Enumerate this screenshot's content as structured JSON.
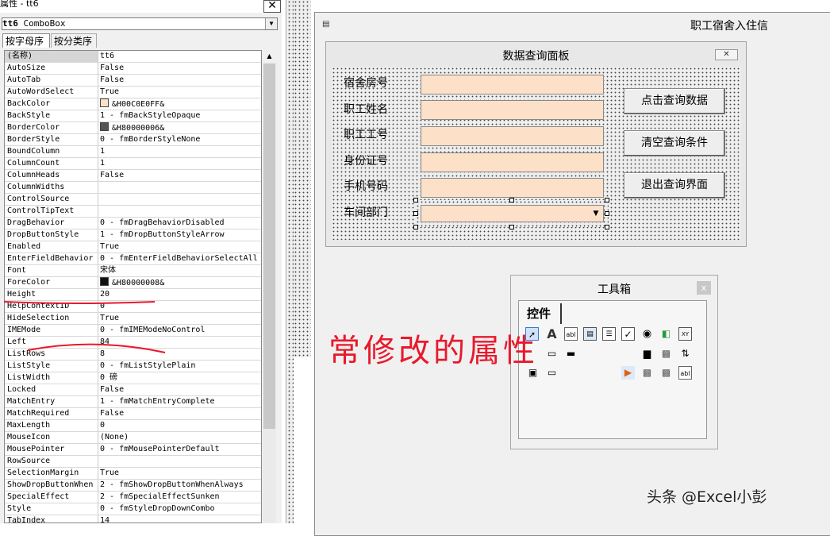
{
  "properties_window": {
    "title": "属性 - tt6",
    "close_glyph": "✕",
    "object_name": "tt6",
    "object_type": "ComboBox",
    "tab_alphabetic": "按字母序",
    "tab_categorized": "按分类序",
    "rows": [
      {
        "name": "(名称)",
        "value": "tt6"
      },
      {
        "name": "AutoSize",
        "value": "False"
      },
      {
        "name": "AutoTab",
        "value": "False"
      },
      {
        "name": "AutoWordSelect",
        "value": "True"
      },
      {
        "name": "BackColor",
        "value": "&H00C0E0FF&",
        "swatch": "#fde0c8"
      },
      {
        "name": "BackStyle",
        "value": "1 - fmBackStyleOpaque"
      },
      {
        "name": "BorderColor",
        "value": "&H80000006&",
        "swatch": "#555555"
      },
      {
        "name": "BorderStyle",
        "value": "0 - fmBorderStyleNone"
      },
      {
        "name": "BoundColumn",
        "value": "1"
      },
      {
        "name": "ColumnCount",
        "value": "1"
      },
      {
        "name": "ColumnHeads",
        "value": "False"
      },
      {
        "name": "ColumnWidths",
        "value": ""
      },
      {
        "name": "ControlSource",
        "value": ""
      },
      {
        "name": "ControlTipText",
        "value": ""
      },
      {
        "name": "DragBehavior",
        "value": "0 - fmDragBehaviorDisabled"
      },
      {
        "name": "DropButtonStyle",
        "value": "1 - fmDropButtonStyleArrow"
      },
      {
        "name": "Enabled",
        "value": "True"
      },
      {
        "name": "EnterFieldBehavior",
        "value": "0 - fmEnterFieldBehaviorSelectAll"
      },
      {
        "name": "Font",
        "value": "宋体"
      },
      {
        "name": "ForeColor",
        "value": "&H80000008&",
        "swatch": "#111111"
      },
      {
        "name": "Height",
        "value": "20"
      },
      {
        "name": "HelpContextID",
        "value": "0"
      },
      {
        "name": "HideSelection",
        "value": "True"
      },
      {
        "name": "IMEMode",
        "value": "0 - fmIMEModeNoControl"
      },
      {
        "name": "Left",
        "value": "84"
      },
      {
        "name": "ListRows",
        "value": "8"
      },
      {
        "name": "ListStyle",
        "value": "0 - fmListStylePlain"
      },
      {
        "name": "ListWidth",
        "value": "0 磅"
      },
      {
        "name": "Locked",
        "value": "False"
      },
      {
        "name": "MatchEntry",
        "value": "1 - fmMatchEntryComplete"
      },
      {
        "name": "MatchRequired",
        "value": "False"
      },
      {
        "name": "MaxLength",
        "value": "0"
      },
      {
        "name": "MouseIcon",
        "value": "(None)"
      },
      {
        "name": "MousePointer",
        "value": "0 - fmMousePointerDefault"
      },
      {
        "name": "RowSource",
        "value": ""
      },
      {
        "name": "SelectionMargin",
        "value": "True"
      },
      {
        "name": "ShowDropButtonWhen",
        "value": "2 - fmShowDropButtonWhenAlways"
      },
      {
        "name": "SpecialEffect",
        "value": "2 - fmSpecialEffectSunken"
      },
      {
        "name": "Style",
        "value": "0 - fmStyleDropDownCombo"
      },
      {
        "name": "TabIndex",
        "value": "14"
      }
    ]
  },
  "form": {
    "outer_title": "职工宿舍入住信",
    "inner_title": "数据查询面板",
    "inner_close": "✕",
    "labels": [
      "宿舍房号",
      "职工姓名",
      "职工工号",
      "身份证号",
      "手机号码",
      "车间部门"
    ],
    "buttons": [
      "点击查询数据",
      "清空查询条件",
      "退出查询界面"
    ],
    "field_color": "#fde0c8"
  },
  "toolbox": {
    "title": "工具箱",
    "close_glyph": "x",
    "tab_label": "控件",
    "icons": [
      "pointer-icon",
      "label-icon",
      "textbox-icon",
      "combobox-icon",
      "listbox-icon",
      "checkbox-icon",
      "optionbutton-icon",
      "togglebutton-icon",
      "frame-icon",
      "commandbutton-icon",
      "tabstrip-icon",
      "multipage-icon",
      "scrollbar-icon",
      "spinbutton-icon",
      "image-icon",
      "refedit-icon"
    ]
  },
  "annotation": {
    "text": "常修改的属性",
    "color": "#e8192c"
  },
  "watermark": {
    "text": "头条 @Excel小彭"
  }
}
